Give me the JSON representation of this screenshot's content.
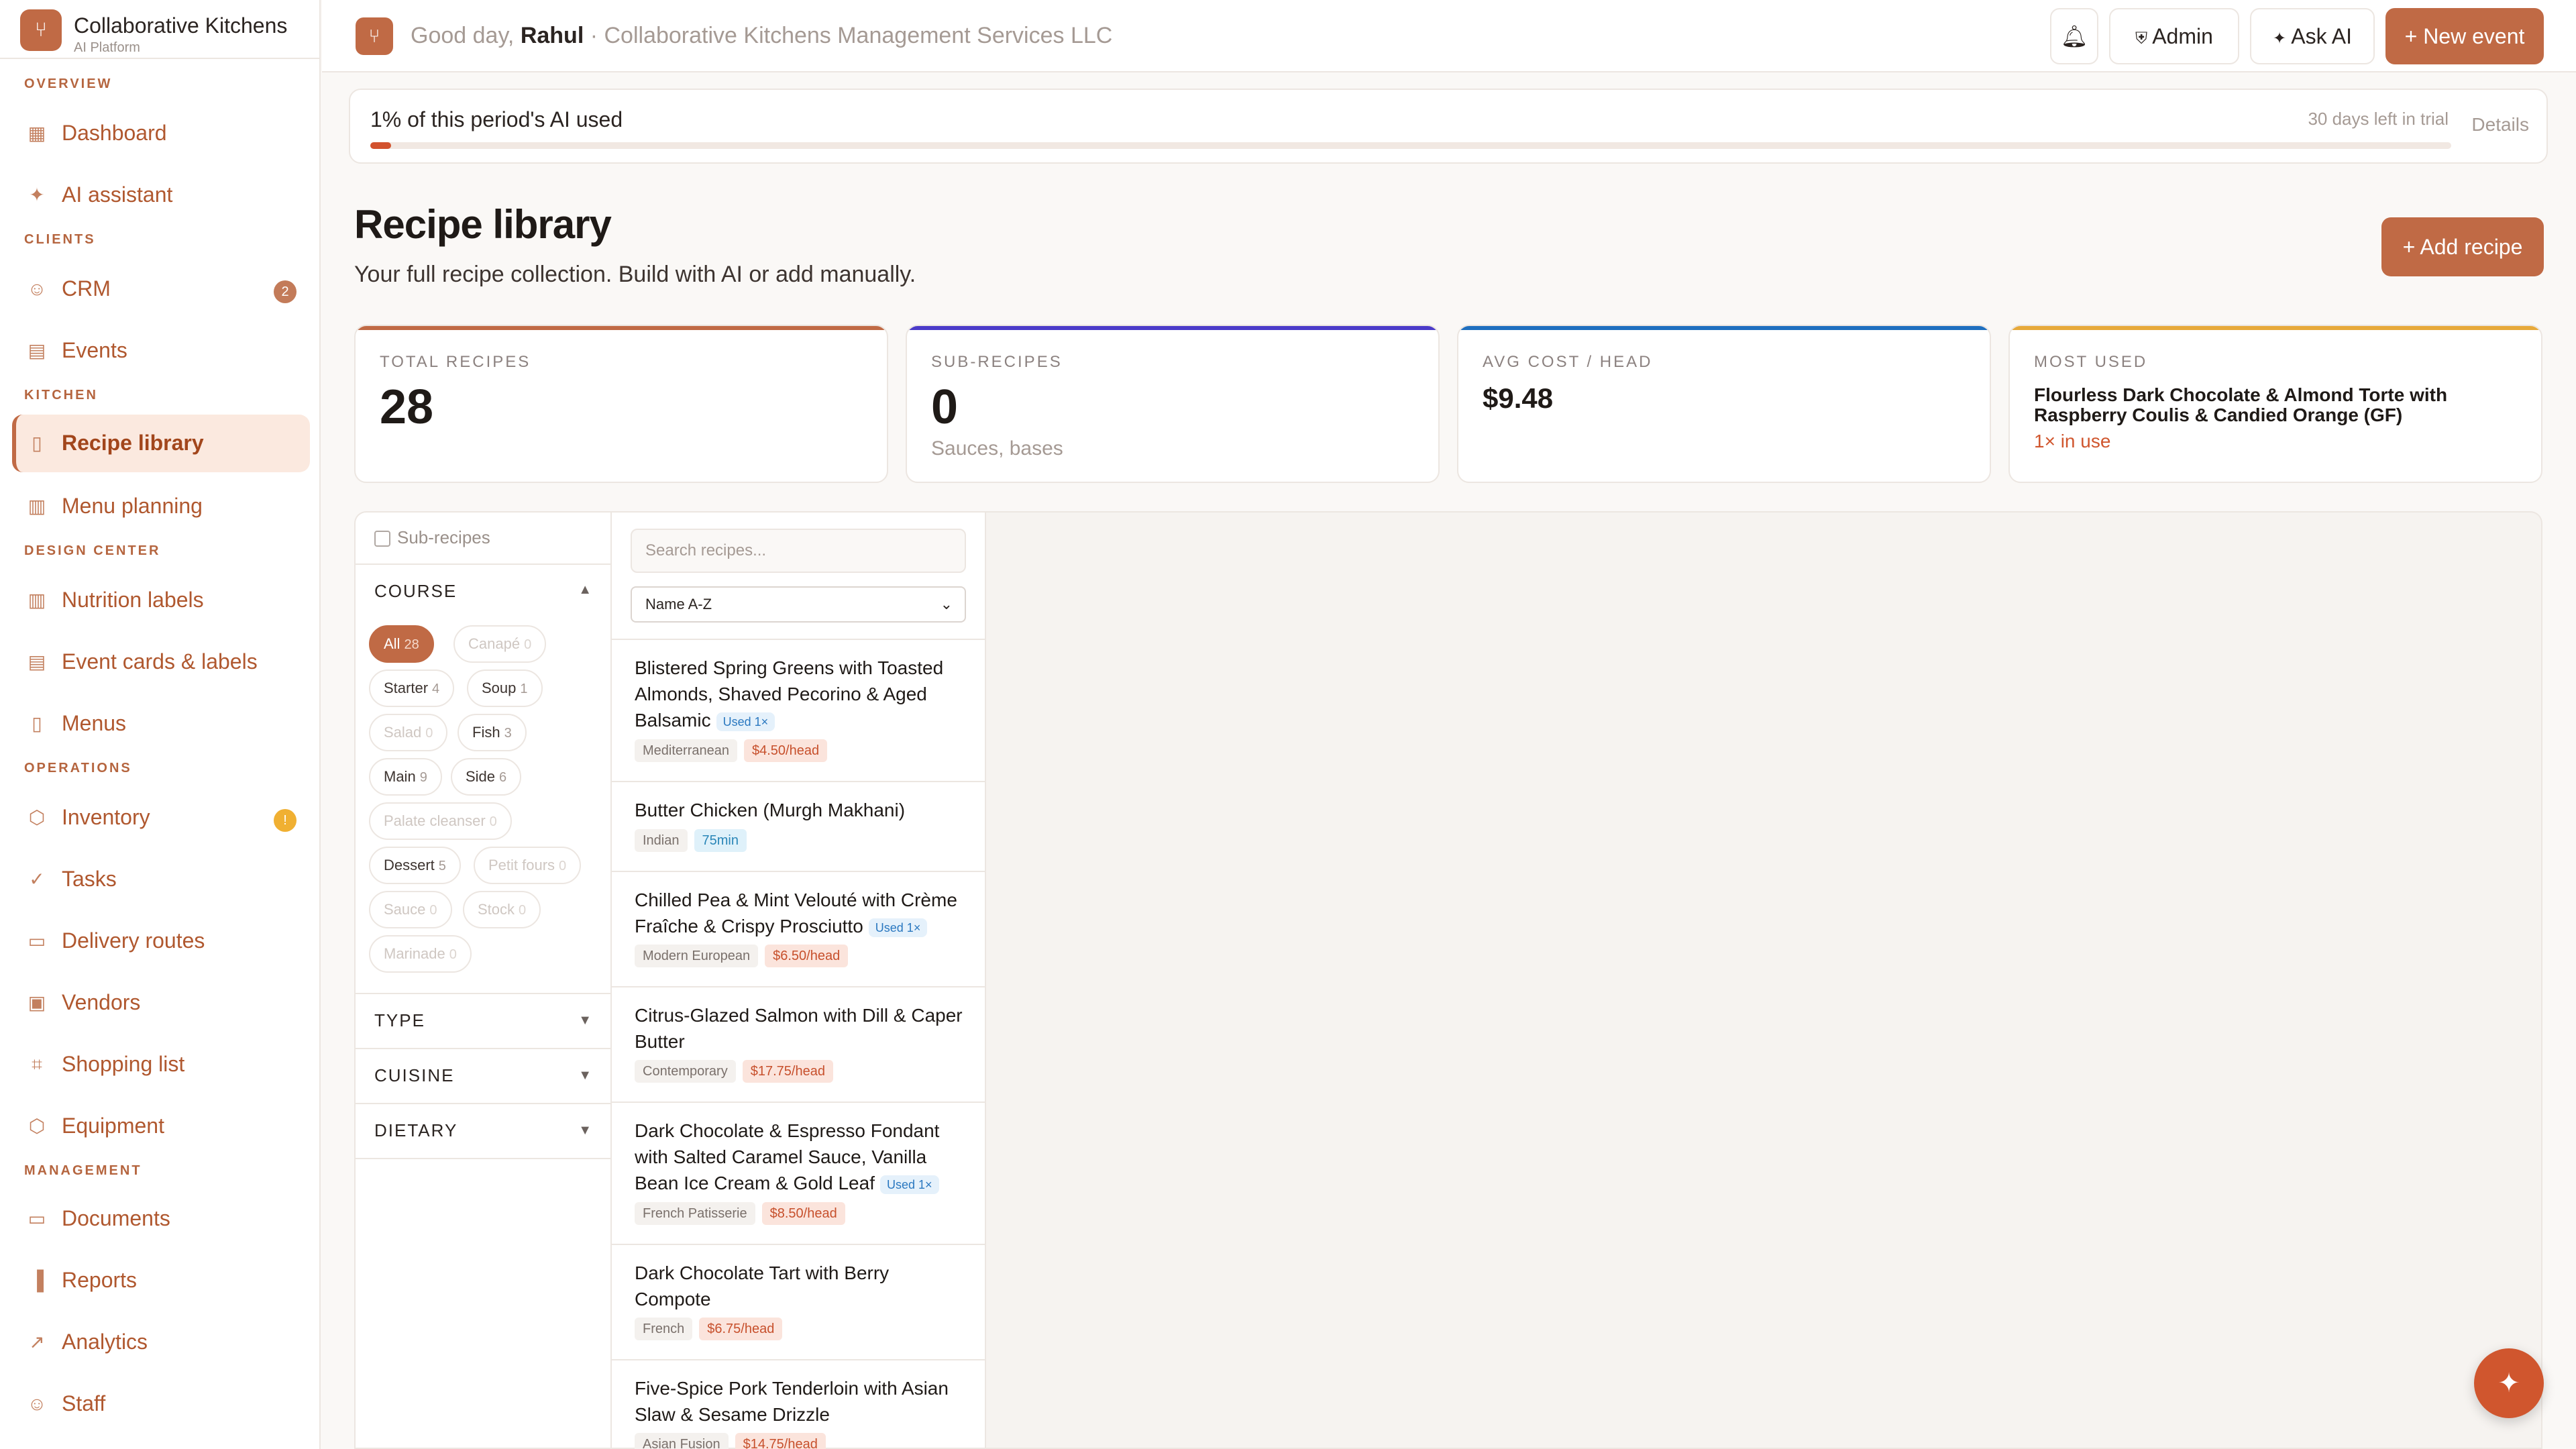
{
  "brand": {
    "name": "Collaborative Kitchens",
    "sub": "AI Platform"
  },
  "sidebar": {
    "sections": [
      {
        "title": "OVERVIEW",
        "items": [
          {
            "label": "Dashboard",
            "icon": "grid-icon"
          },
          {
            "label": "AI assistant",
            "icon": "sparkle-icon"
          }
        ]
      },
      {
        "title": "CLIENTS",
        "items": [
          {
            "label": "CRM",
            "icon": "users-icon",
            "badge": "2"
          },
          {
            "label": "Events",
            "icon": "calendar-icon"
          }
        ]
      },
      {
        "title": "KITCHEN",
        "items": [
          {
            "label": "Recipe library",
            "icon": "book-icon",
            "active": true
          },
          {
            "label": "Menu planning",
            "icon": "clipboard-icon"
          }
        ]
      },
      {
        "title": "DESIGN CENTER",
        "items": [
          {
            "label": "Nutrition labels",
            "icon": "clipboard-icon"
          },
          {
            "label": "Event cards & labels",
            "icon": "document-icon"
          },
          {
            "label": "Menus",
            "icon": "book-icon"
          }
        ]
      },
      {
        "title": "OPERATIONS",
        "items": [
          {
            "label": "Inventory",
            "icon": "box-icon",
            "badge": "!"
          },
          {
            "label": "Tasks",
            "icon": "check-circle-icon"
          },
          {
            "label": "Delivery routes",
            "icon": "truck-icon"
          },
          {
            "label": "Vendors",
            "icon": "store-icon"
          },
          {
            "label": "Shopping list",
            "icon": "cart-icon"
          },
          {
            "label": "Equipment",
            "icon": "box-icon"
          }
        ]
      },
      {
        "title": "MANAGEMENT",
        "items": [
          {
            "label": "Documents",
            "icon": "folder-icon"
          },
          {
            "label": "Reports",
            "icon": "bar-chart-icon"
          },
          {
            "label": "Analytics",
            "icon": "trend-icon"
          },
          {
            "label": "Staff",
            "icon": "users-icon"
          }
        ]
      }
    ]
  },
  "topbar": {
    "greeting_prefix": "Good day,",
    "user": "Rahul",
    "company": "· Collaborative Kitchens Management Services LLC",
    "admin_label": "Admin",
    "ask_ai_label": "Ask AI",
    "new_event_label": "+ New event"
  },
  "usage": {
    "label": "1% of this period's AI used",
    "trial": "30 days left in trial",
    "details": "Details",
    "percent": 1
  },
  "page": {
    "title": "Recipe library",
    "subtitle": "Your full recipe collection. Build with AI or add manually.",
    "add_label": "+ Add recipe"
  },
  "stats": [
    {
      "label": "TOTAL RECIPES",
      "value": "28",
      "color": "#c06a45"
    },
    {
      "label": "SUB-RECIPES",
      "value": "0",
      "note": "Sauces, bases",
      "color": "#4b3bc9"
    },
    {
      "label": "AVG COST / HEAD",
      "value": "$9.48",
      "color": "#1f6fbf"
    },
    {
      "label": "MOST USED",
      "title": "Flourless Dark Chocolate & Almond Torte with Raspberry Coulis & Candied Orange (GF)",
      "link": "1× in use",
      "color": "#e7a93a"
    }
  ],
  "filters": {
    "subrecipes_label": "Sub-recipes",
    "course_label": "COURSE",
    "course_chips": [
      {
        "label": "All",
        "count": "28",
        "state": "active"
      },
      {
        "label": "Canapé",
        "count": "0",
        "state": "dim"
      },
      {
        "label": "Starter",
        "count": "4",
        "state": "normal"
      },
      {
        "label": "Soup",
        "count": "1",
        "state": "normal"
      },
      {
        "label": "Salad",
        "count": "0",
        "state": "dim"
      },
      {
        "label": "Fish",
        "count": "3",
        "state": "normal"
      },
      {
        "label": "Main",
        "count": "9",
        "state": "normal"
      },
      {
        "label": "Side",
        "count": "6",
        "state": "normal"
      },
      {
        "label": "Palate cleanser",
        "count": "0",
        "state": "dim"
      },
      {
        "label": "Dessert",
        "count": "5",
        "state": "normal"
      },
      {
        "label": "Petit fours",
        "count": "0",
        "state": "dim"
      },
      {
        "label": "Sauce",
        "count": "0",
        "state": "dim"
      },
      {
        "label": "Stock",
        "count": "0",
        "state": "dim"
      },
      {
        "label": "Marinade",
        "count": "0",
        "state": "dim"
      }
    ],
    "type_label": "TYPE",
    "cuisine_label": "CUISINE",
    "dietary_label": "DIETARY"
  },
  "list": {
    "search_placeholder": "Search recipes...",
    "sort_value": "Name A-Z",
    "recipes": [
      {
        "title": "Blistered Spring Greens with Toasted Almonds, Shaved Pecorino & Aged Balsamic",
        "used": "Used 1×",
        "cuisine": "Mediterranean",
        "price": "$4.50/head"
      },
      {
        "title": "Butter Chicken (Murgh Makhani)",
        "cuisine": "Indian",
        "time": "75min"
      },
      {
        "title": "Chilled Pea & Mint Velouté with Crème Fraîche & Crispy Prosciutto",
        "used": "Used 1×",
        "cuisine": "Modern European",
        "price": "$6.50/head"
      },
      {
        "title": "Citrus-Glazed Salmon with Dill & Caper Butter",
        "cuisine": "Contemporary",
        "price": "$17.75/head"
      },
      {
        "title": "Dark Chocolate & Espresso Fondant with Salted Caramel Sauce, Vanilla Bean Ice Cream & Gold Leaf",
        "used": "Used 1×",
        "cuisine": "French Patisserie",
        "price": "$8.50/head"
      },
      {
        "title": "Dark Chocolate Tart with Berry Compote",
        "cuisine": "French",
        "price": "$6.75/head"
      },
      {
        "title": "Five-Spice Pork Tenderloin with Asian Slaw & Sesame Drizzle",
        "cuisine": "Asian Fusion",
        "price": "$14.75/head"
      }
    ]
  },
  "fab_icon": "sparkle-icon"
}
